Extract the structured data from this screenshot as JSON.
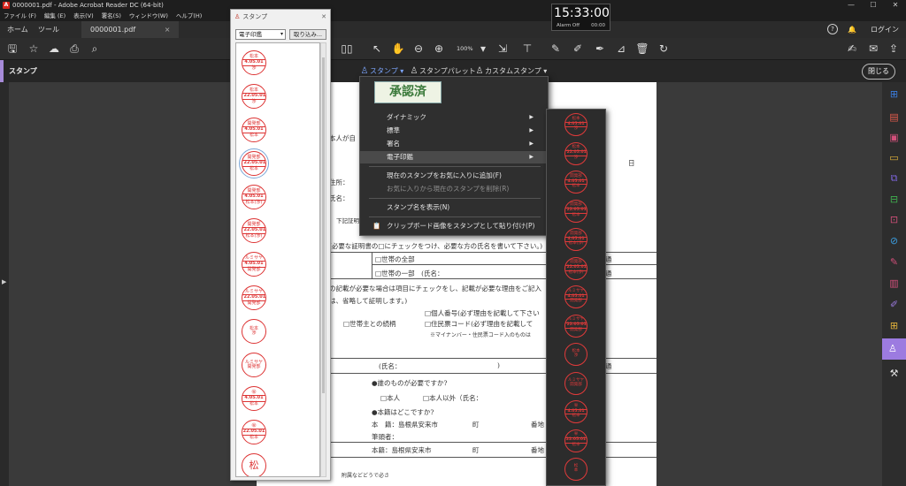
{
  "window": {
    "title": "0000001.pdf - Adobe Acrobat Reader DC (64-bit)",
    "app_icon": "A"
  },
  "menubar": [
    "ファイル (F)",
    "編集 (E)",
    "表示(V)",
    "署名(S)",
    "ウィンドウ(W)",
    "ヘルプ(H)"
  ],
  "tabs": {
    "home": "ホーム",
    "tools": "ツール",
    "document": "0000001.pdf",
    "close_glyph": "×"
  },
  "account": {
    "help": "?",
    "login": "ログイン"
  },
  "toolbar": {
    "zoom": "100%"
  },
  "clock": {
    "time": "15:33:00",
    "alarm_label": "Alarm Off",
    "alarm_time": "00:00"
  },
  "stampbar": {
    "tool_label": "スタンプ",
    "stamp_menu": "スタンプ",
    "stamp_palette": "スタンプパレット",
    "custom_stamp": "カスタムスタンプ",
    "close": "閉じる"
  },
  "palette": {
    "title": "スタンプ",
    "category": "電子印鑑",
    "import_button": "取り込み...",
    "stamps": [
      {
        "top": "松本",
        "mid": "4.05.01",
        "bottom": "渉"
      },
      {
        "top": "松本",
        "mid": "'22.05.01",
        "bottom": "渉"
      },
      {
        "top": "開発部",
        "mid": "4.05.01",
        "bottom": "松本"
      },
      {
        "top": "開発部",
        "mid": "'22.05.01",
        "bottom": "松本"
      },
      {
        "top": "開発部",
        "mid": "4.05.01",
        "bottom": "松本(渉)"
      },
      {
        "top": "開発部",
        "mid": "'22.05.01",
        "bottom": "松本(渉)"
      },
      {
        "top": "ルミサヤ",
        "mid": "4.05.01",
        "bottom": "開発部"
      },
      {
        "top": "ルミサヤ",
        "mid": "'22.05.01",
        "bottom": "開発部"
      },
      {
        "top": "松本",
        "mid": "",
        "bottom": "渉"
      },
      {
        "top": "ルミサヤ",
        "mid": "",
        "bottom": "開発部"
      },
      {
        "top": "㊙",
        "mid": "4.05.01",
        "bottom": "松本"
      },
      {
        "top": "㊙",
        "mid": "22.05.01",
        "bottom": "松本"
      },
      {
        "top": "松",
        "mid": "",
        "bottom": ""
      }
    ]
  },
  "menu": {
    "preview": "承認済",
    "items": [
      {
        "label": "ダイナミック",
        "arrow": "▶"
      },
      {
        "label": "標準",
        "arrow": "▶"
      },
      {
        "label": "署名",
        "arrow": "▶"
      },
      {
        "label": "電子印鑑",
        "arrow": "▶"
      },
      {
        "label": "現在のスタンプをお気に入りに追加(F)"
      },
      {
        "label": "お気に入りから現在のスタンプを削除(R)"
      },
      {
        "label": "スタンプ名を表示(N)"
      },
      {
        "label": "クリップボード画像をスタンプとして貼り付け(P)"
      }
    ]
  },
  "submenu": {
    "stamps": [
      {
        "top": "松本",
        "mid": "4.05.01",
        "bottom": "渉"
      },
      {
        "top": "松本",
        "mid": "'22.05.01",
        "bottom": "渉"
      },
      {
        "top": "開発部",
        "mid": "4.05.01",
        "bottom": "松本"
      },
      {
        "top": "開発部",
        "mid": "'22.05.01",
        "bottom": "松本"
      },
      {
        "top": "開発部",
        "mid": "4.05.01",
        "bottom": "松本(渉)"
      },
      {
        "top": "開発部",
        "mid": "'22.05.01",
        "bottom": "松本(渉)"
      },
      {
        "top": "ルミサヤ",
        "mid": "4.05.01",
        "bottom": "開発部"
      },
      {
        "top": "ルミサヤ",
        "mid": "'22.05.01",
        "bottom": "開発部"
      },
      {
        "top": "松本",
        "mid": "",
        "bottom": "渉"
      },
      {
        "top": "ルミサヤ",
        "mid": "",
        "bottom": "開発部"
      },
      {
        "top": "㊙",
        "mid": "4.05.01",
        "bottom": "松本"
      },
      {
        "top": "㊙",
        "mid": "22.05.01",
        "bottom": "松本"
      },
      {
        "top": "松",
        "mid": "",
        "bottom": "本"
      }
    ]
  },
  "document": {
    "t1": "本人が自",
    "t2": "日",
    "t3": "住所：",
    "t4": "氏名：",
    "t5": "下記証明",
    "t6": "(必要な証明書の□にチェックをつけ、必要な方の氏名を書いて下さい。)",
    "t7": "□世帯の全部",
    "t8": "□世帯の一部　(氏名：",
    "t9": "通",
    "t10": "の記載が必要な場合は項目にチェックをし、記載が必要な理由をご記入",
    "t11": "は、省略して証明します。)",
    "t12": "□世帯主との続柄",
    "t13": "□個人番号(必ず理由を記載して下さい",
    "t14": "□住民票コード(必ず理由を記載して",
    "t15": "※マイナンバー・住民票コード入のものは",
    "t16": "(氏名：",
    "t17": ")",
    "t18": "●誰のものが必要ですか?",
    "t19": "□本人",
    "t20": "□本人以外（氏名：",
    "t21": "●本籍はどこですか?",
    "t22": "本　籍：島根県安来市",
    "t23": "町",
    "t24": "番地",
    "t25": "筆頭者：",
    "t26": "本籍：島根県安来市",
    "t27": "附属などどうで必さ"
  }
}
